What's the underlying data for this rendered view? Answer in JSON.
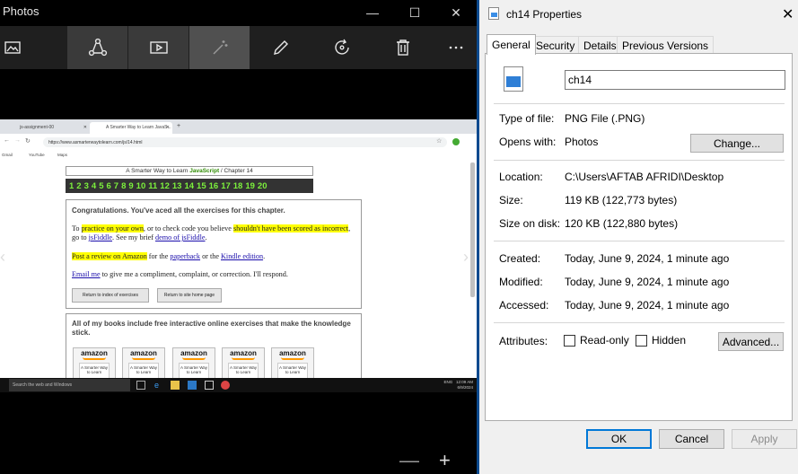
{
  "photos": {
    "title": "Photos",
    "window_controls": [
      "—",
      "☐",
      "✕"
    ],
    "zoom_out": "—",
    "zoom_in": "+",
    "nav_prev": "‹",
    "nav_next": "›"
  },
  "screenshot": {
    "tabs": [
      "js-assignment-00",
      "A Smarter Way to Learn JavaS..."
    ],
    "new_tab": "+",
    "url": "https://www.asmarterwaytolearn.com/js/14.html",
    "bookmarks": [
      "Gmail",
      "YouTube",
      "Maps"
    ],
    "site_header_prefix": "A Smarter Way to Learn ",
    "site_header_js": "JavaScript",
    "site_header_suffix": " / Chapter 14",
    "chapter_numbers": [
      "1",
      "2",
      "3",
      "4",
      "5",
      "6",
      "7",
      "8",
      "9",
      "10",
      "11",
      "12",
      "13",
      "14",
      "15",
      "16",
      "17",
      "18",
      "19",
      "20"
    ],
    "congrats": "Congratulations. You've aced all the exercises for this chapter.",
    "p1_a": "To ",
    "p1_hl1": "practice on your own",
    "p1_b": ", or to check code you believe ",
    "p1_hl2": "shouldn't have been scored as incorrect",
    "p1_c": ", go to ",
    "p1_link1": "jsFiddle",
    "p1_d": ". See my brief ",
    "p1_link2": "demo of jsFiddle",
    "p1_e": ".",
    "p2_hl": "Post a review on Amazon",
    "p2_a": " for the ",
    "p2_link1": "paperback",
    "p2_b": " or the ",
    "p2_link2": "Kindle edition",
    "p2_c": ".",
    "p3_link": "Email me",
    "p3_a": " to give me a compliment, complaint, or correction. I'll respond.",
    "btn_index": "Return to index of exercises",
    "btn_home": "Return to site home page",
    "books_text": "All of my books include free interactive online exercises that make the knowledge stick.",
    "book_brand": "amazon",
    "book_cover": "A Smarter Way to Learn",
    "taskbar_search": "Search the web and Windows",
    "tray_lang": "ENG",
    "tray_time": "12:09 AM",
    "tray_date": "6/9/2024"
  },
  "dialog": {
    "title": "ch14 Properties",
    "close": "✕",
    "tabs": [
      "General",
      "Security",
      "Details",
      "Previous Versions"
    ],
    "file_name": "ch14",
    "type_label": "Type of file:",
    "type_value": "PNG File (.PNG)",
    "opens_label": "Opens with:",
    "opens_value": "Photos",
    "change_btn": "Change...",
    "location_label": "Location:",
    "location_value": "C:\\Users\\AFTAB AFRIDI\\Desktop",
    "size_label": "Size:",
    "size_value": "119 KB (122,773 bytes)",
    "size_disk_label": "Size on disk:",
    "size_disk_value": "120 KB (122,880 bytes)",
    "created_label": "Created:",
    "created_value": "Today, June 9, 2024, 1 minute ago",
    "modified_label": "Modified:",
    "modified_value": "Today, June 9, 2024, 1 minute ago",
    "accessed_label": "Accessed:",
    "accessed_value": "Today, June 9, 2024, 1 minute ago",
    "attributes_label": "Attributes:",
    "readonly_label": "Read-only",
    "hidden_label": "Hidden",
    "advanced_btn": "Advanced...",
    "ok_btn": "OK",
    "cancel_btn": "Cancel",
    "apply_btn": "Apply"
  }
}
